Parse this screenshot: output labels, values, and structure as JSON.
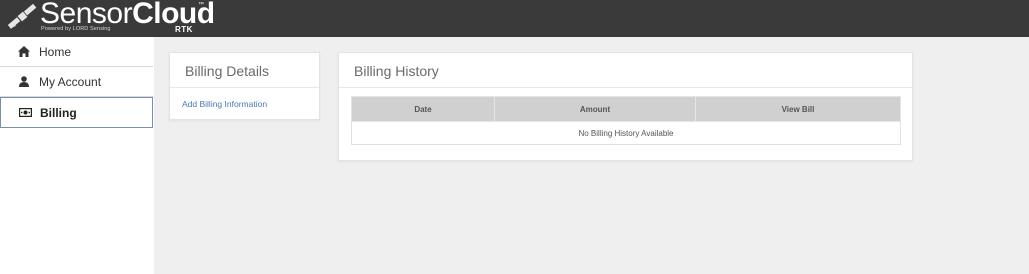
{
  "header": {
    "logo_light": "Sensor",
    "logo_bold": "Cloud",
    "logo_tm": "™",
    "logo_powered": "Powered by LORD Sensing",
    "logo_rtk": "RTK"
  },
  "sidebar": {
    "items": [
      {
        "label": "Home",
        "icon": "home-icon"
      },
      {
        "label": "My Account",
        "icon": "user-icon"
      },
      {
        "label": "Billing",
        "icon": "money-icon",
        "active": true
      }
    ]
  },
  "details": {
    "title": "Billing Details",
    "link": "Add Billing Information"
  },
  "history": {
    "title": "Billing History",
    "columns": [
      "Date",
      "Amount",
      "View Bill"
    ],
    "empty_text": "No Billing History Available"
  },
  "colors": {
    "header_bg": "#3a3a3a",
    "link": "#4a78b5",
    "active_border": "#7a8fb0",
    "table_header_bg": "#d0d0d0",
    "page_bg": "#efefef"
  }
}
